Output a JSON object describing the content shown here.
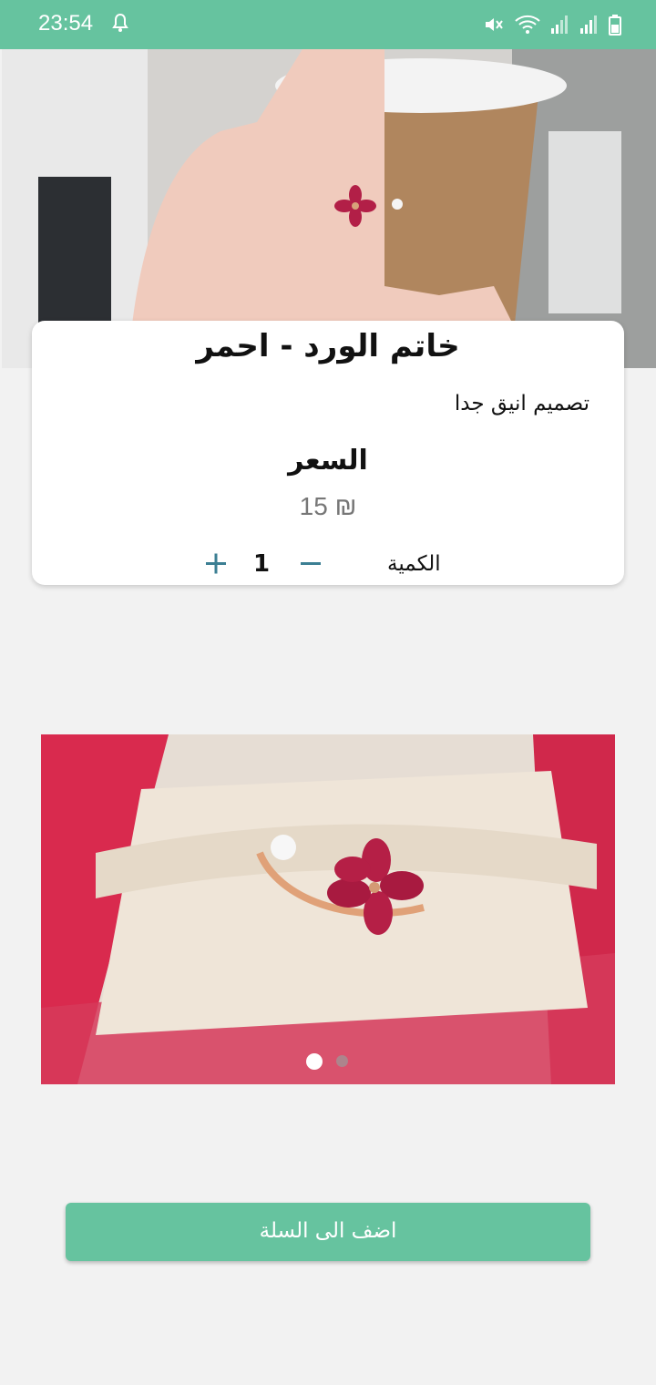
{
  "status_bar": {
    "time": "23:54"
  },
  "product": {
    "title": "خاتم الورد - احمر",
    "description": "تصميم انيق جدا",
    "price_label": "السعر",
    "price_value": "15 ₪"
  },
  "quantity": {
    "label": "الكمية",
    "value": "1",
    "minus": "−",
    "plus": "+"
  },
  "carousel": {
    "slide_count": 2,
    "active_index": 0
  },
  "actions": {
    "add_to_cart": "اضف الى السلة"
  },
  "colors": {
    "accent": "#66c39f",
    "stepper": "#3c7f93"
  }
}
